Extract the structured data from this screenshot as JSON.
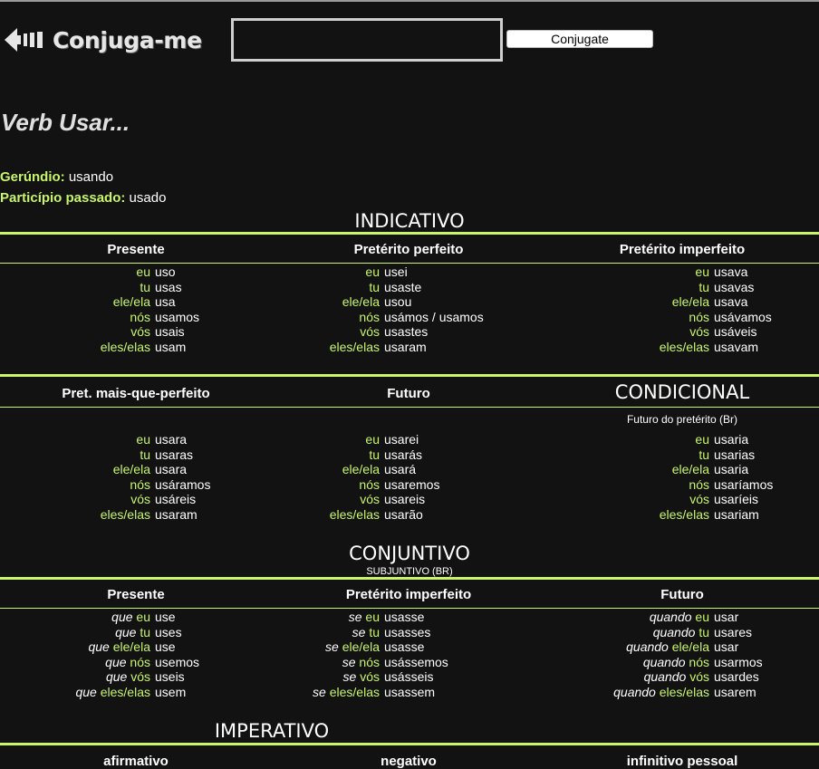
{
  "header": {
    "logo_text": "Conjuga-me",
    "search": {
      "value": "",
      "placeholder": ""
    },
    "button_label": "Conjugate"
  },
  "verb_title": "Verb Usar...",
  "info": {
    "gerundio_label": "Gerúndio:",
    "gerundio_value": "usando",
    "participio_label": "Particípio passado:",
    "participio_value": "usado"
  },
  "sections": {
    "indicativo": "INDICATIVO",
    "condicional": "CONDICIONAL",
    "condicional_note": "Futuro do pretérito (Br)",
    "conjuntivo": "CONJUNTIVO",
    "conjuntivo_sub": "SUBJUNTIVO (BR)",
    "imperativo": "IMPERATIVO"
  },
  "pronouns": [
    "eu",
    "tu",
    "ele/ela",
    "nós",
    "vós",
    "eles/elas"
  ],
  "tenses": {
    "presente": {
      "label": "Presente",
      "forms": [
        "uso",
        "usas",
        "usa",
        "usamos",
        "usais",
        "usam"
      ]
    },
    "perfeito": {
      "label": "Pretérito perfeito",
      "forms": [
        "usei",
        "usaste",
        "usou",
        "usámos / usamos",
        "usastes",
        "usaram"
      ]
    },
    "imperfeito": {
      "label": "Pretérito imperfeito",
      "forms": [
        "usava",
        "usavas",
        "usava",
        "usávamos",
        "usáveis",
        "usavam"
      ]
    },
    "mais_que": {
      "label": "Pret. mais-que-perfeito",
      "forms": [
        "usara",
        "usaras",
        "usara",
        "usáramos",
        "usáreis",
        "usaram"
      ]
    },
    "futuro": {
      "label": "Futuro",
      "forms": [
        "usarei",
        "usarás",
        "usará",
        "usaremos",
        "usareis",
        "usarão"
      ]
    },
    "condicional": {
      "forms": [
        "usaria",
        "usarias",
        "usaria",
        "usaríamos",
        "usaríeis",
        "usariam"
      ]
    },
    "conj_presente": {
      "label": "Presente",
      "prefix": "que",
      "forms": [
        "use",
        "uses",
        "use",
        "usemos",
        "useis",
        "usem"
      ]
    },
    "conj_imperfeito": {
      "label": "Pretérito imperfeito",
      "prefix": "se",
      "forms": [
        "usasse",
        "usasses",
        "usasse",
        "usássemos",
        "usásseis",
        "usassem"
      ]
    },
    "conj_futuro": {
      "label": "Futuro",
      "prefix": "quando",
      "forms": [
        "usar",
        "usares",
        "usar",
        "usarmos",
        "usardes",
        "usarem"
      ]
    }
  },
  "imperativo_heads": [
    "afirmativo",
    "negativo",
    "infinitivo pessoal"
  ],
  "colors": {
    "accent": "#c8f56a",
    "background": "#121212",
    "text": "#ffffff"
  }
}
